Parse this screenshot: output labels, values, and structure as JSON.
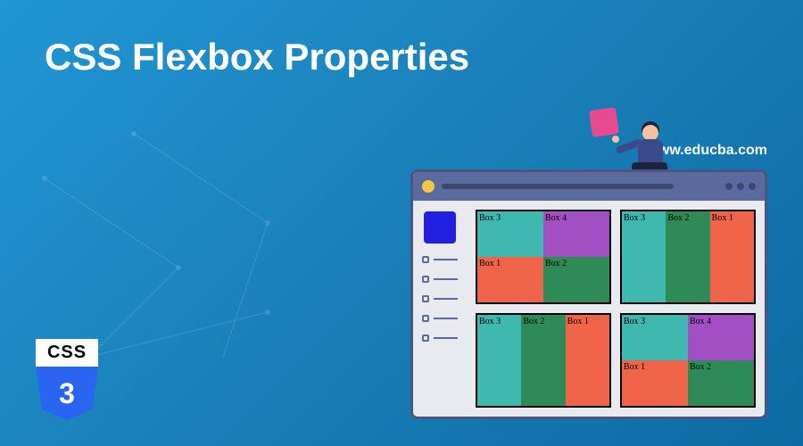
{
  "title": "CSS Flexbox Properties",
  "website": "www.educba.com",
  "css_logo": {
    "top_label": "CSS",
    "shield_number": "3"
  },
  "panels": {
    "panel1": {
      "box1": "Box 1",
      "box2": "Box 2",
      "box3": "Box 3",
      "box4": "Box 4"
    },
    "panel2": {
      "box1": "Box 1",
      "box2": "Box 2",
      "box3": "Box 3"
    },
    "panel3": {
      "box1": "Box 1",
      "box2": "Box 2",
      "box3": "Box 3"
    },
    "panel4": {
      "box1": "Box 1",
      "box2": "Box 2",
      "box3": "Box 3",
      "box4": "Box 4"
    }
  },
  "colors": {
    "bg_gradient_start": "#2196d4",
    "bg_gradient_end": "#0d6aa3",
    "box_teal": "#3fb8af",
    "box_green": "#2e8b57",
    "box_orange": "#f06449",
    "box_purple": "#a34fc4",
    "sidebar_blue": "#2020e0",
    "browser_purple": "#5b6a9e",
    "pink_square": "#e84a8f"
  }
}
